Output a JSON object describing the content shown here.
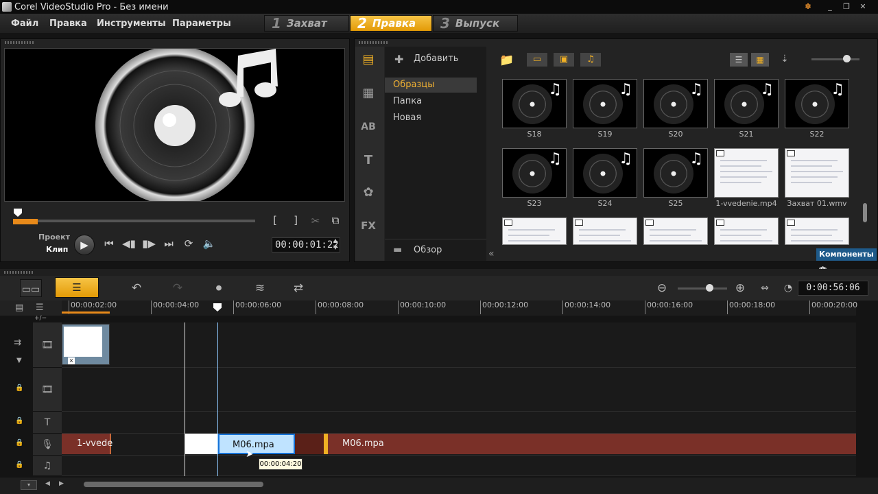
{
  "window": {
    "title": "Corel VideoStudio Pro - Без имени"
  },
  "menu": {
    "items": [
      "Файл",
      "Правка",
      "Инструменты",
      "Параметры"
    ]
  },
  "steps": [
    {
      "num": "1",
      "label": "Захват",
      "active": false
    },
    {
      "num": "2",
      "label": "Правка",
      "active": true
    },
    {
      "num": "3",
      "label": "Выпуск",
      "active": false
    }
  ],
  "player": {
    "mode_project": "Проект",
    "mode_clip": "Клип",
    "timecode": "00:00:01:22"
  },
  "library": {
    "add_label": "Добавить",
    "folders": [
      "Образцы",
      "Папка",
      "Новая"
    ],
    "browse_label": "Обзор",
    "components_label": "Компоненты",
    "thumbs": [
      {
        "label": "S18",
        "kind": "audio"
      },
      {
        "label": "S19",
        "kind": "audio"
      },
      {
        "label": "S20",
        "kind": "audio"
      },
      {
        "label": "S21",
        "kind": "audio"
      },
      {
        "label": "S22",
        "kind": "audio"
      },
      {
        "label": "S23",
        "kind": "audio"
      },
      {
        "label": "S24",
        "kind": "audio"
      },
      {
        "label": "S25",
        "kind": "audio"
      },
      {
        "label": "1-vvedenie.mp4",
        "kind": "video"
      },
      {
        "label": "Захват 01.wmv",
        "kind": "video"
      },
      {
        "label": "",
        "kind": "video"
      },
      {
        "label": "",
        "kind": "video"
      },
      {
        "label": "",
        "kind": "video"
      },
      {
        "label": "",
        "kind": "video"
      },
      {
        "label": "",
        "kind": "video"
      }
    ]
  },
  "timeline": {
    "duration": "0:00:56:06",
    "ruler_ticks": [
      "00:00:02:00",
      "00:00:04:00",
      "00:00:06:00",
      "00:00:08:00",
      "00:00:10:00",
      "00:00:12:00",
      "00:00:14:00",
      "00:00:16:00",
      "00:00:18:00",
      "00:00:20:00"
    ],
    "voice_clips": {
      "clip1": "1-vvede",
      "clip2": "M06.mpa",
      "clip3": "M06.mpa"
    },
    "tooltip": "00:00:04:20",
    "add_remove": "+/−"
  }
}
